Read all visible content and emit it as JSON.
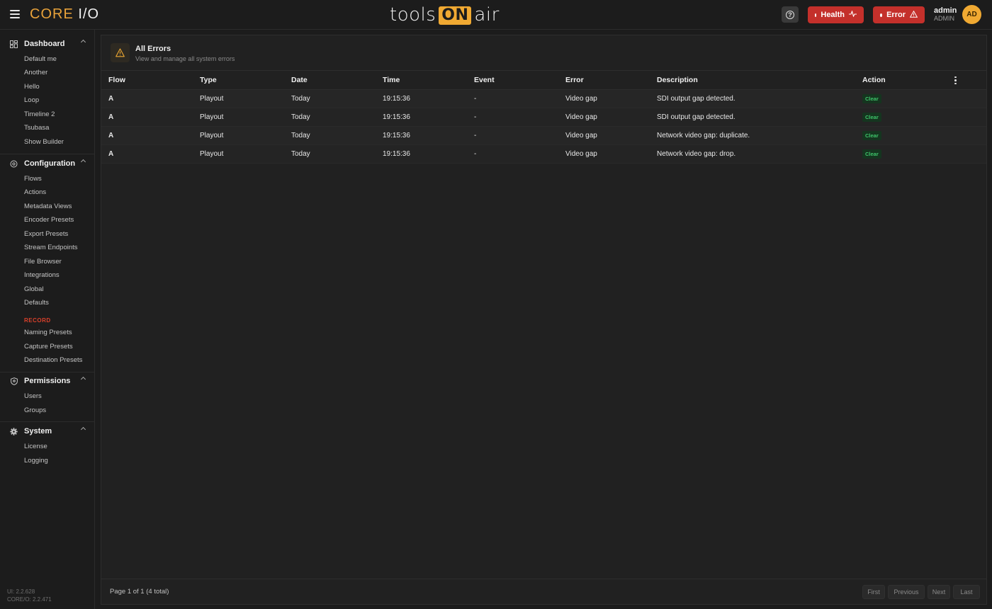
{
  "header": {
    "brand_core": "CORE",
    "brand_io": "I/O",
    "center_tools": "tools",
    "center_on": "ON",
    "center_air": "air",
    "help_icon": "question-circle-icon",
    "health_label": "Health",
    "error_label": "Error",
    "user_name": "admin",
    "user_role": "ADMIN",
    "avatar_initials": "AD"
  },
  "sidebar": {
    "dashboard": {
      "title": "Dashboard",
      "items": [
        "Default me",
        "Another",
        "Hello",
        "Loop",
        "Timeline 2",
        "Tsubasa",
        "Show Builder"
      ]
    },
    "configuration": {
      "title": "Configuration",
      "items": [
        "Flows",
        "Actions",
        "Metadata Views",
        "Encoder Presets",
        "Export Presets",
        "Stream Endpoints",
        "File Browser",
        "Integrations",
        "Global",
        "Defaults"
      ],
      "record_label": "RECORD",
      "record_items": [
        "Naming Presets",
        "Capture Presets",
        "Destination Presets"
      ]
    },
    "permissions": {
      "title": "Permissions",
      "items": [
        "Users",
        "Groups"
      ]
    },
    "system": {
      "title": "System",
      "items": [
        "License",
        "Logging"
      ]
    },
    "version_ui": "UI: 2.2.628",
    "version_core": "CORE/O: 2.2.471"
  },
  "panel": {
    "title": "All Errors",
    "subtitle": "View and manage all system errors",
    "columns": [
      "Flow",
      "Type",
      "Date",
      "Time",
      "Event",
      "Error",
      "Description",
      "Action"
    ],
    "rows": [
      {
        "flow": "A",
        "type": "Playout",
        "date": "Today",
        "time": "19:15:36",
        "event": "-",
        "error": "Video gap",
        "description": "SDI output gap detected.",
        "action": "Clear"
      },
      {
        "flow": "A",
        "type": "Playout",
        "date": "Today",
        "time": "19:15:36",
        "event": "-",
        "error": "Video gap",
        "description": "SDI output gap detected.",
        "action": "Clear"
      },
      {
        "flow": "A",
        "type": "Playout",
        "date": "Today",
        "time": "19:15:36",
        "event": "-",
        "error": "Video gap",
        "description": "Network video gap: duplicate.",
        "action": "Clear"
      },
      {
        "flow": "A",
        "type": "Playout",
        "date": "Today",
        "time": "19:15:36",
        "event": "-",
        "error": "Video gap",
        "description": "Network video gap: drop.",
        "action": "Clear"
      }
    ],
    "page_info": "Page 1 of 1 (4 total)",
    "pagination": {
      "first": "First",
      "previous": "Previous",
      "next": "Next",
      "last": "Last"
    }
  },
  "colors": {
    "accent": "#f0a932",
    "danger": "#c4302b",
    "record": "#d9402b",
    "success": "#3ec46a"
  }
}
